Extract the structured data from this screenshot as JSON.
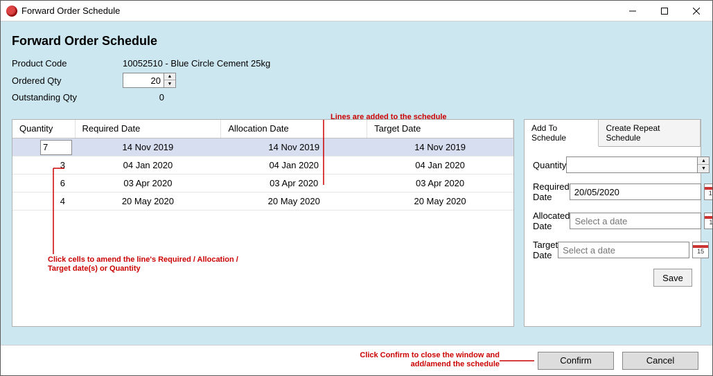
{
  "window": {
    "title": "Forward Order Schedule"
  },
  "page": {
    "heading": "Forward Order Schedule"
  },
  "product": {
    "code_label": "Product Code",
    "code_value": "10052510 - Blue Circle Cement 25kg",
    "ordered_label": "Ordered Qty",
    "ordered_value": "20",
    "outstanding_label": "Outstanding Qty",
    "outstanding_value": "0"
  },
  "table": {
    "headers": {
      "qty": "Quantity",
      "required": "Required Date",
      "allocation": "Allocation Date",
      "target": "Target Date"
    },
    "rows": [
      {
        "qty": "7",
        "required": "14 Nov 2019",
        "allocation": "14 Nov 2019",
        "target": "14 Nov 2019",
        "selected": true
      },
      {
        "qty": "3",
        "required": "04 Jan 2020",
        "allocation": "04 Jan 2020",
        "target": "04 Jan 2020",
        "selected": false
      },
      {
        "qty": "6",
        "required": "03 Apr 2020",
        "allocation": "03 Apr 2020",
        "target": "03 Apr 2020",
        "selected": false
      },
      {
        "qty": "4",
        "required": "20 May 2020",
        "allocation": "20 May 2020",
        "target": "20 May 2020",
        "selected": false
      }
    ]
  },
  "side": {
    "tabs": {
      "add": "Add To Schedule",
      "repeat": "Create Repeat Schedule"
    },
    "quantity_label": "Quantity",
    "quantity_value": "",
    "required_label": "Required Date",
    "required_value": "20/05/2020",
    "allocated_label": "Allocated Date",
    "allocated_placeholder": "Select a date",
    "target_label": "Target Date",
    "target_placeholder": "Select a date",
    "save_label": "Save"
  },
  "footer": {
    "confirm": "Confirm",
    "cancel": "Cancel"
  },
  "annotations": {
    "lines_added": "Lines are added to the schedule",
    "click_cells": "Click cells to amend the line's Required / Allocation / Target date(s) or Quantity",
    "click_confirm": "Click Confirm to close the window and add/amend the schedule"
  },
  "calendar_icon_day": "15"
}
